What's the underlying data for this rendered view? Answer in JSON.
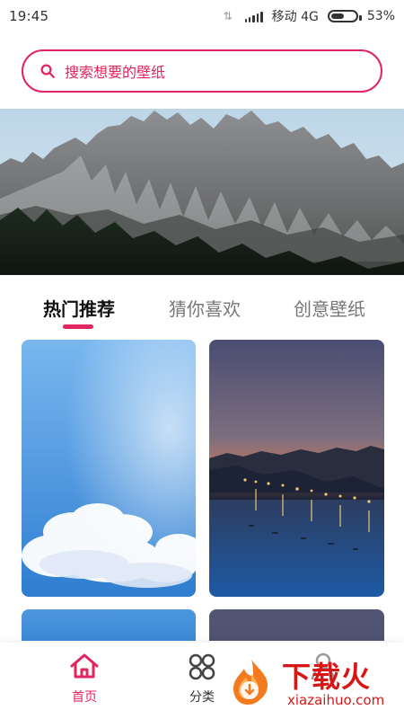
{
  "status_bar": {
    "time": "19:45",
    "carrier": "移动 4G",
    "battery": "53%",
    "battery_level": 0.53
  },
  "search": {
    "placeholder": "搜索想要的壁纸"
  },
  "tabs": [
    {
      "label": "热门推荐",
      "active": true
    },
    {
      "label": "猜你喜欢",
      "active": false
    },
    {
      "label": "创意壁纸",
      "active": false
    }
  ],
  "bottom_nav": [
    {
      "label": "首页",
      "active": true
    },
    {
      "label": "分类",
      "active": false
    },
    {
      "label": "",
      "active": false
    }
  ],
  "watermark": {
    "title": "下载火",
    "url": "xiazaihuo.com"
  },
  "colors": {
    "accent": "#e2255f",
    "watermark": "#d81616"
  }
}
